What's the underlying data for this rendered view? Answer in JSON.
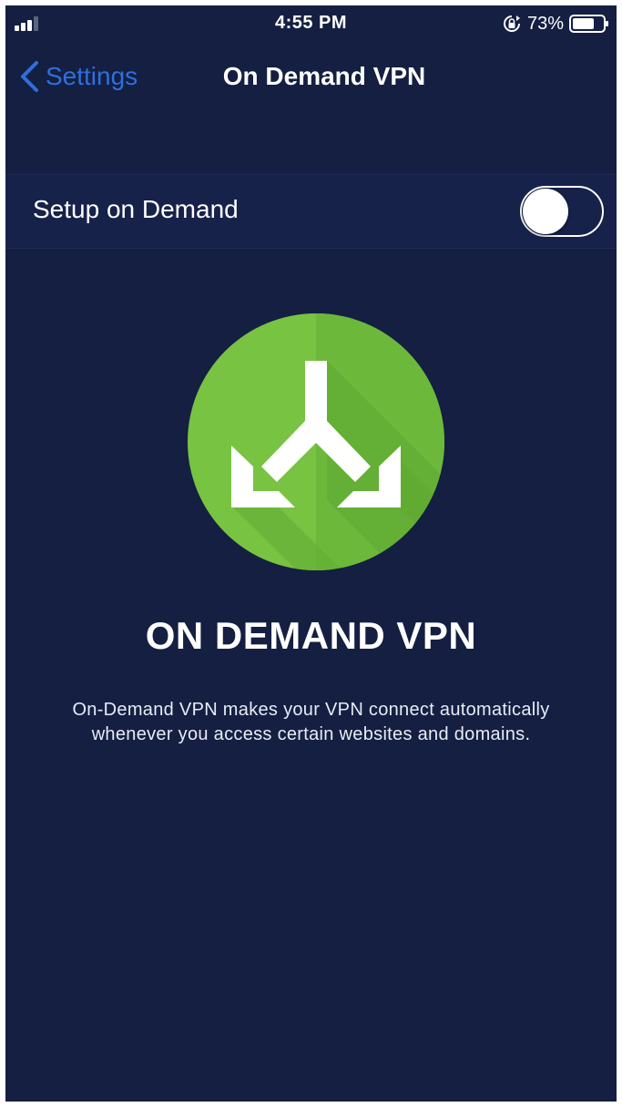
{
  "status_bar": {
    "time": "4:55 PM",
    "battery_percent": "73%",
    "battery_level": 0.73,
    "signal_bars": 3
  },
  "nav": {
    "back_label": "Settings",
    "title": "On Demand VPN"
  },
  "setting": {
    "label": "Setup on Demand",
    "toggle_on": false
  },
  "hero": {
    "icon": "split-arrows-icon",
    "title": "ON DEMAND VPN",
    "description": "On-Demand VPN makes your VPN connect automatically whenever you access certain websites and domains."
  },
  "colors": {
    "background": "#141f42",
    "accent_blue": "#2f6fdc",
    "icon_green": "#6cbf3c"
  }
}
